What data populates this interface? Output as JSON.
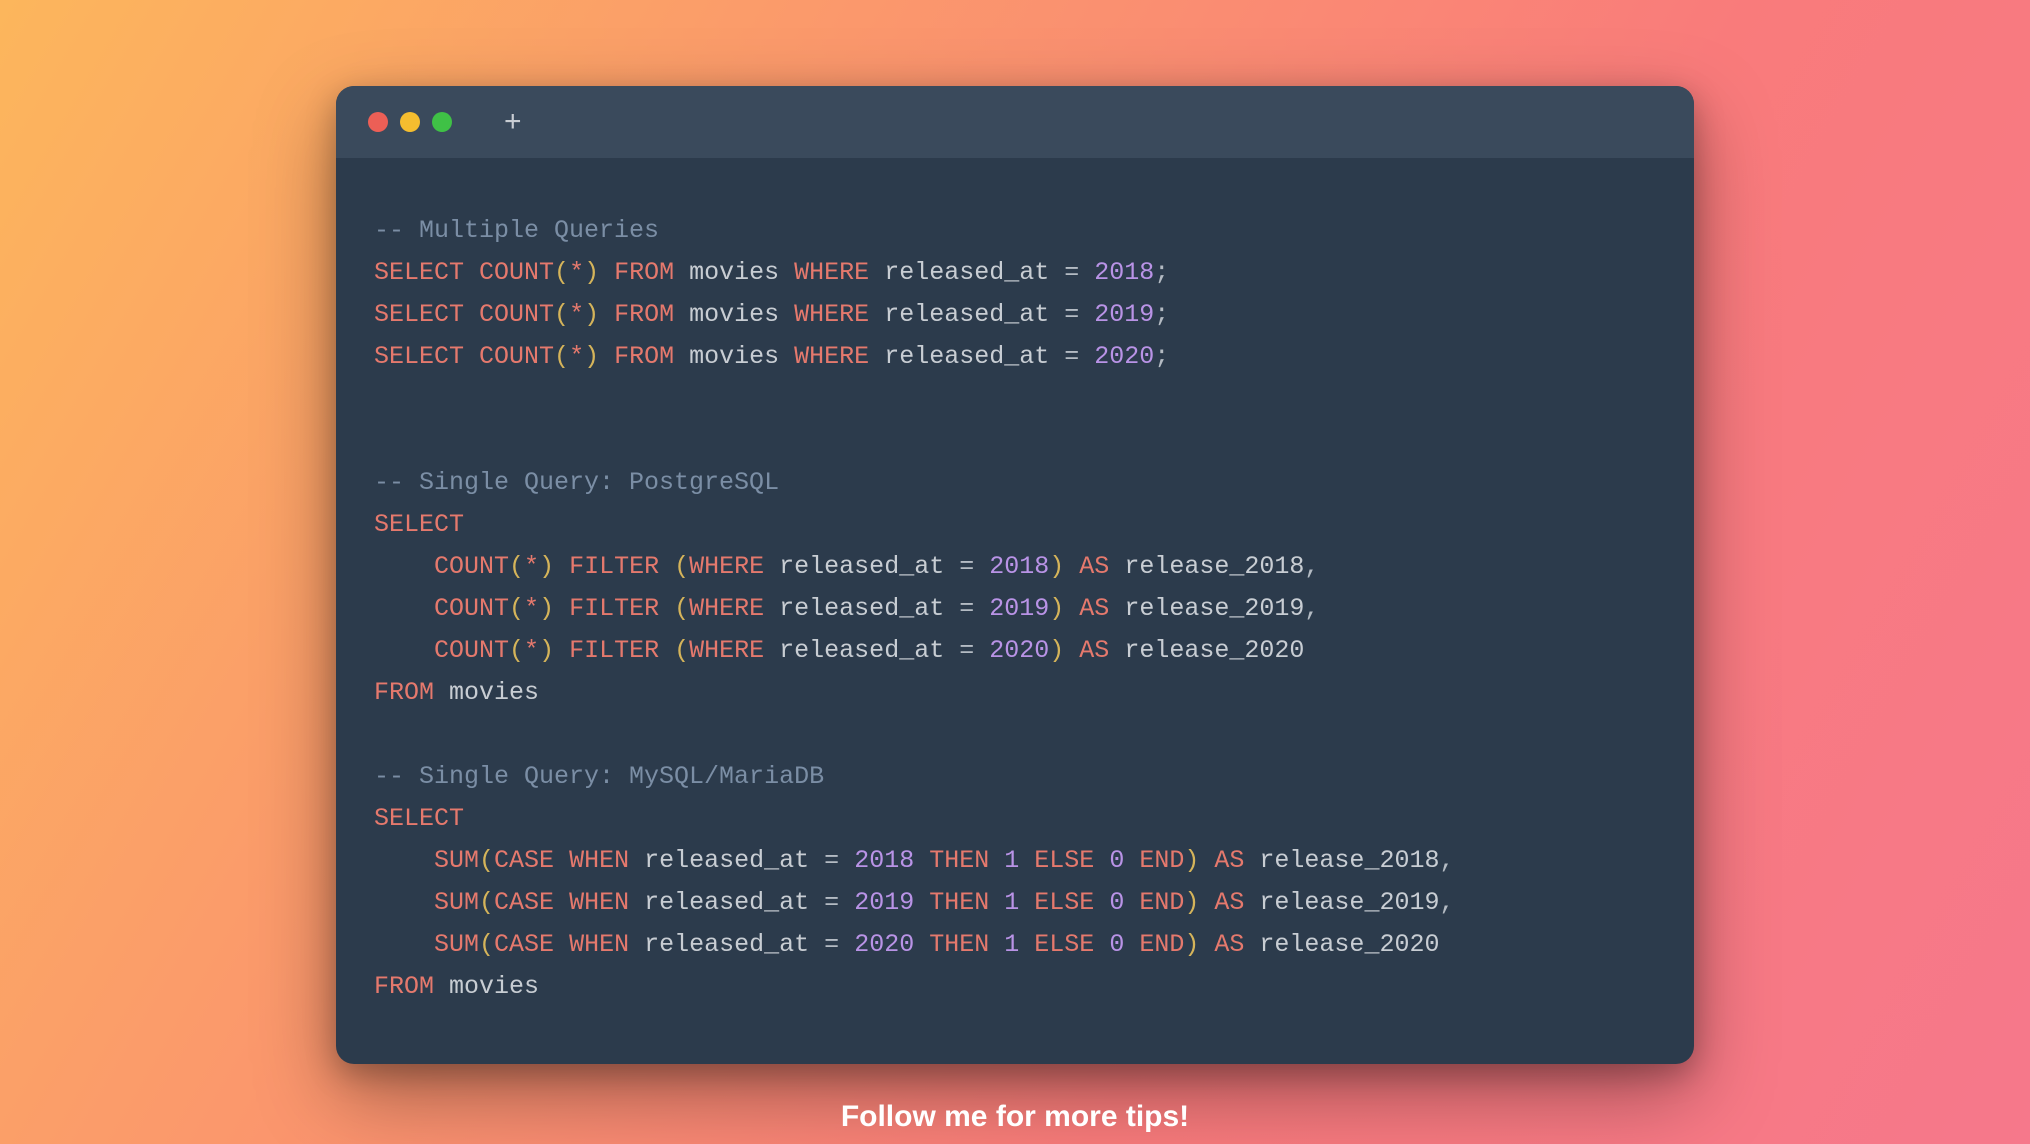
{
  "window": {
    "traffic_lights": {
      "red": "#ec5f56",
      "yellow": "#f4bd2f",
      "green": "#3fc146"
    },
    "new_tab_glyph": "+"
  },
  "code": {
    "comment1": "-- Multiple Queries",
    "line_select": "SELECT",
    "line_count": "COUNT",
    "line_from": "FROM",
    "line_where": "WHERE",
    "line_as": "AS",
    "line_filter": "FILTER",
    "line_sum": "SUM",
    "line_case": "CASE",
    "line_when": "WHEN",
    "line_then": "THEN",
    "line_else": "ELSE",
    "line_end": "END",
    "star": "*",
    "lparen": "(",
    "rparen": ")",
    "eq": "=",
    "semi": ";",
    "comma": ",",
    "table": "movies",
    "col": "released_at",
    "y2018": "2018",
    "y2019": "2019",
    "y2020": "2020",
    "one": "1",
    "zero": "0",
    "alias2018": "release_2018",
    "alias2019": "release_2019",
    "alias2020": "release_2020",
    "comment2": "-- Single Query: PostgreSQL",
    "comment3": "-- Single Query: MySQL/MariaDB",
    "indent": "    "
  },
  "caption": "Follow me for more tips!"
}
